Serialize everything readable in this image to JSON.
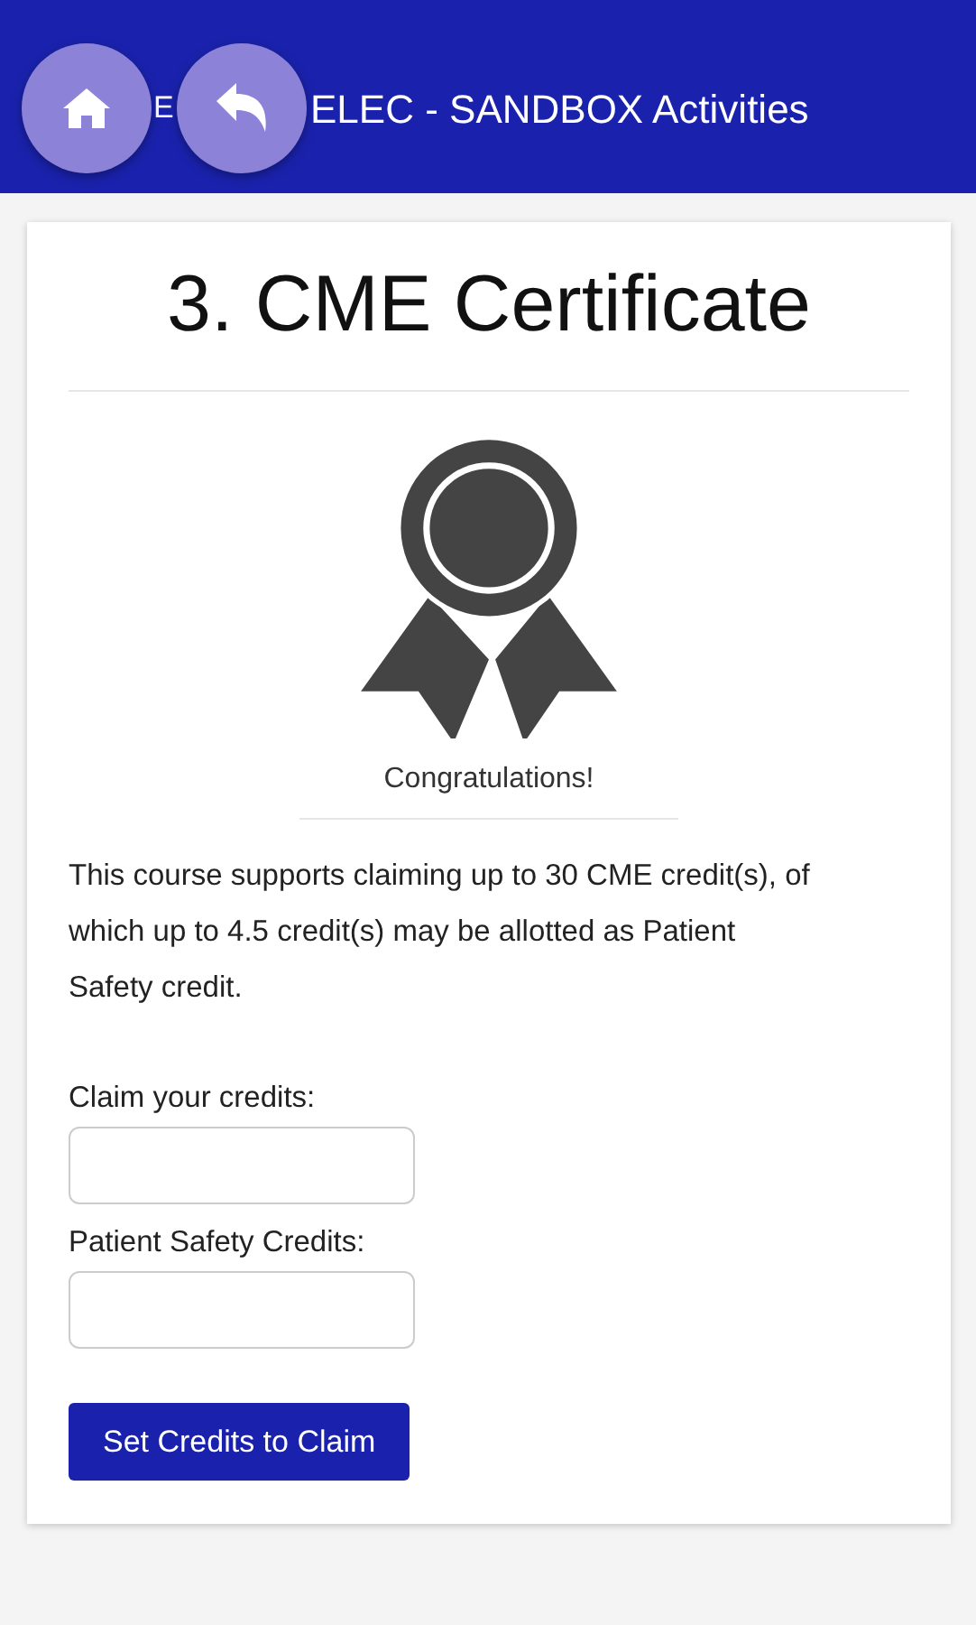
{
  "header": {
    "title_fragment": "E",
    "title": "ELEC - SANDBOX Activities",
    "buttons": [
      {
        "kind": "home"
      },
      {
        "kind": "back"
      }
    ]
  },
  "card": {
    "heading": "3. CME Certificate",
    "message": "Congratulations!",
    "description": "This course supports claiming up to 30 CME credit(s), of which up to 4.5 credit(s) may be allotted as Patient Safety credit.",
    "fields": [
      {
        "label": "Claim your credits:"
      },
      {
        "label": "Patient Safety Credits:"
      }
    ],
    "button": "Set Credits to Claim"
  }
}
